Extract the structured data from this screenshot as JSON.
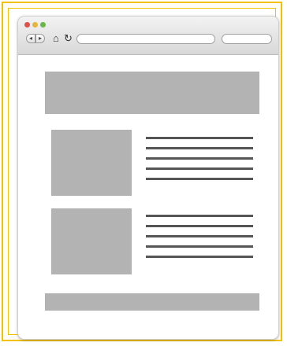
{
  "frame": {
    "border_color": "#f2c200"
  },
  "toolbar": {
    "traffic_lights": [
      "#e2504a",
      "#e4b53a",
      "#68b848"
    ],
    "back_icon": "◂",
    "forward_icon": "▸",
    "home_icon": "⌂",
    "reload_icon": "↻",
    "address_value": "",
    "search_value": ""
  },
  "content": {
    "placeholder_color": "#b3b3b3",
    "text_line_color": "#555555"
  }
}
